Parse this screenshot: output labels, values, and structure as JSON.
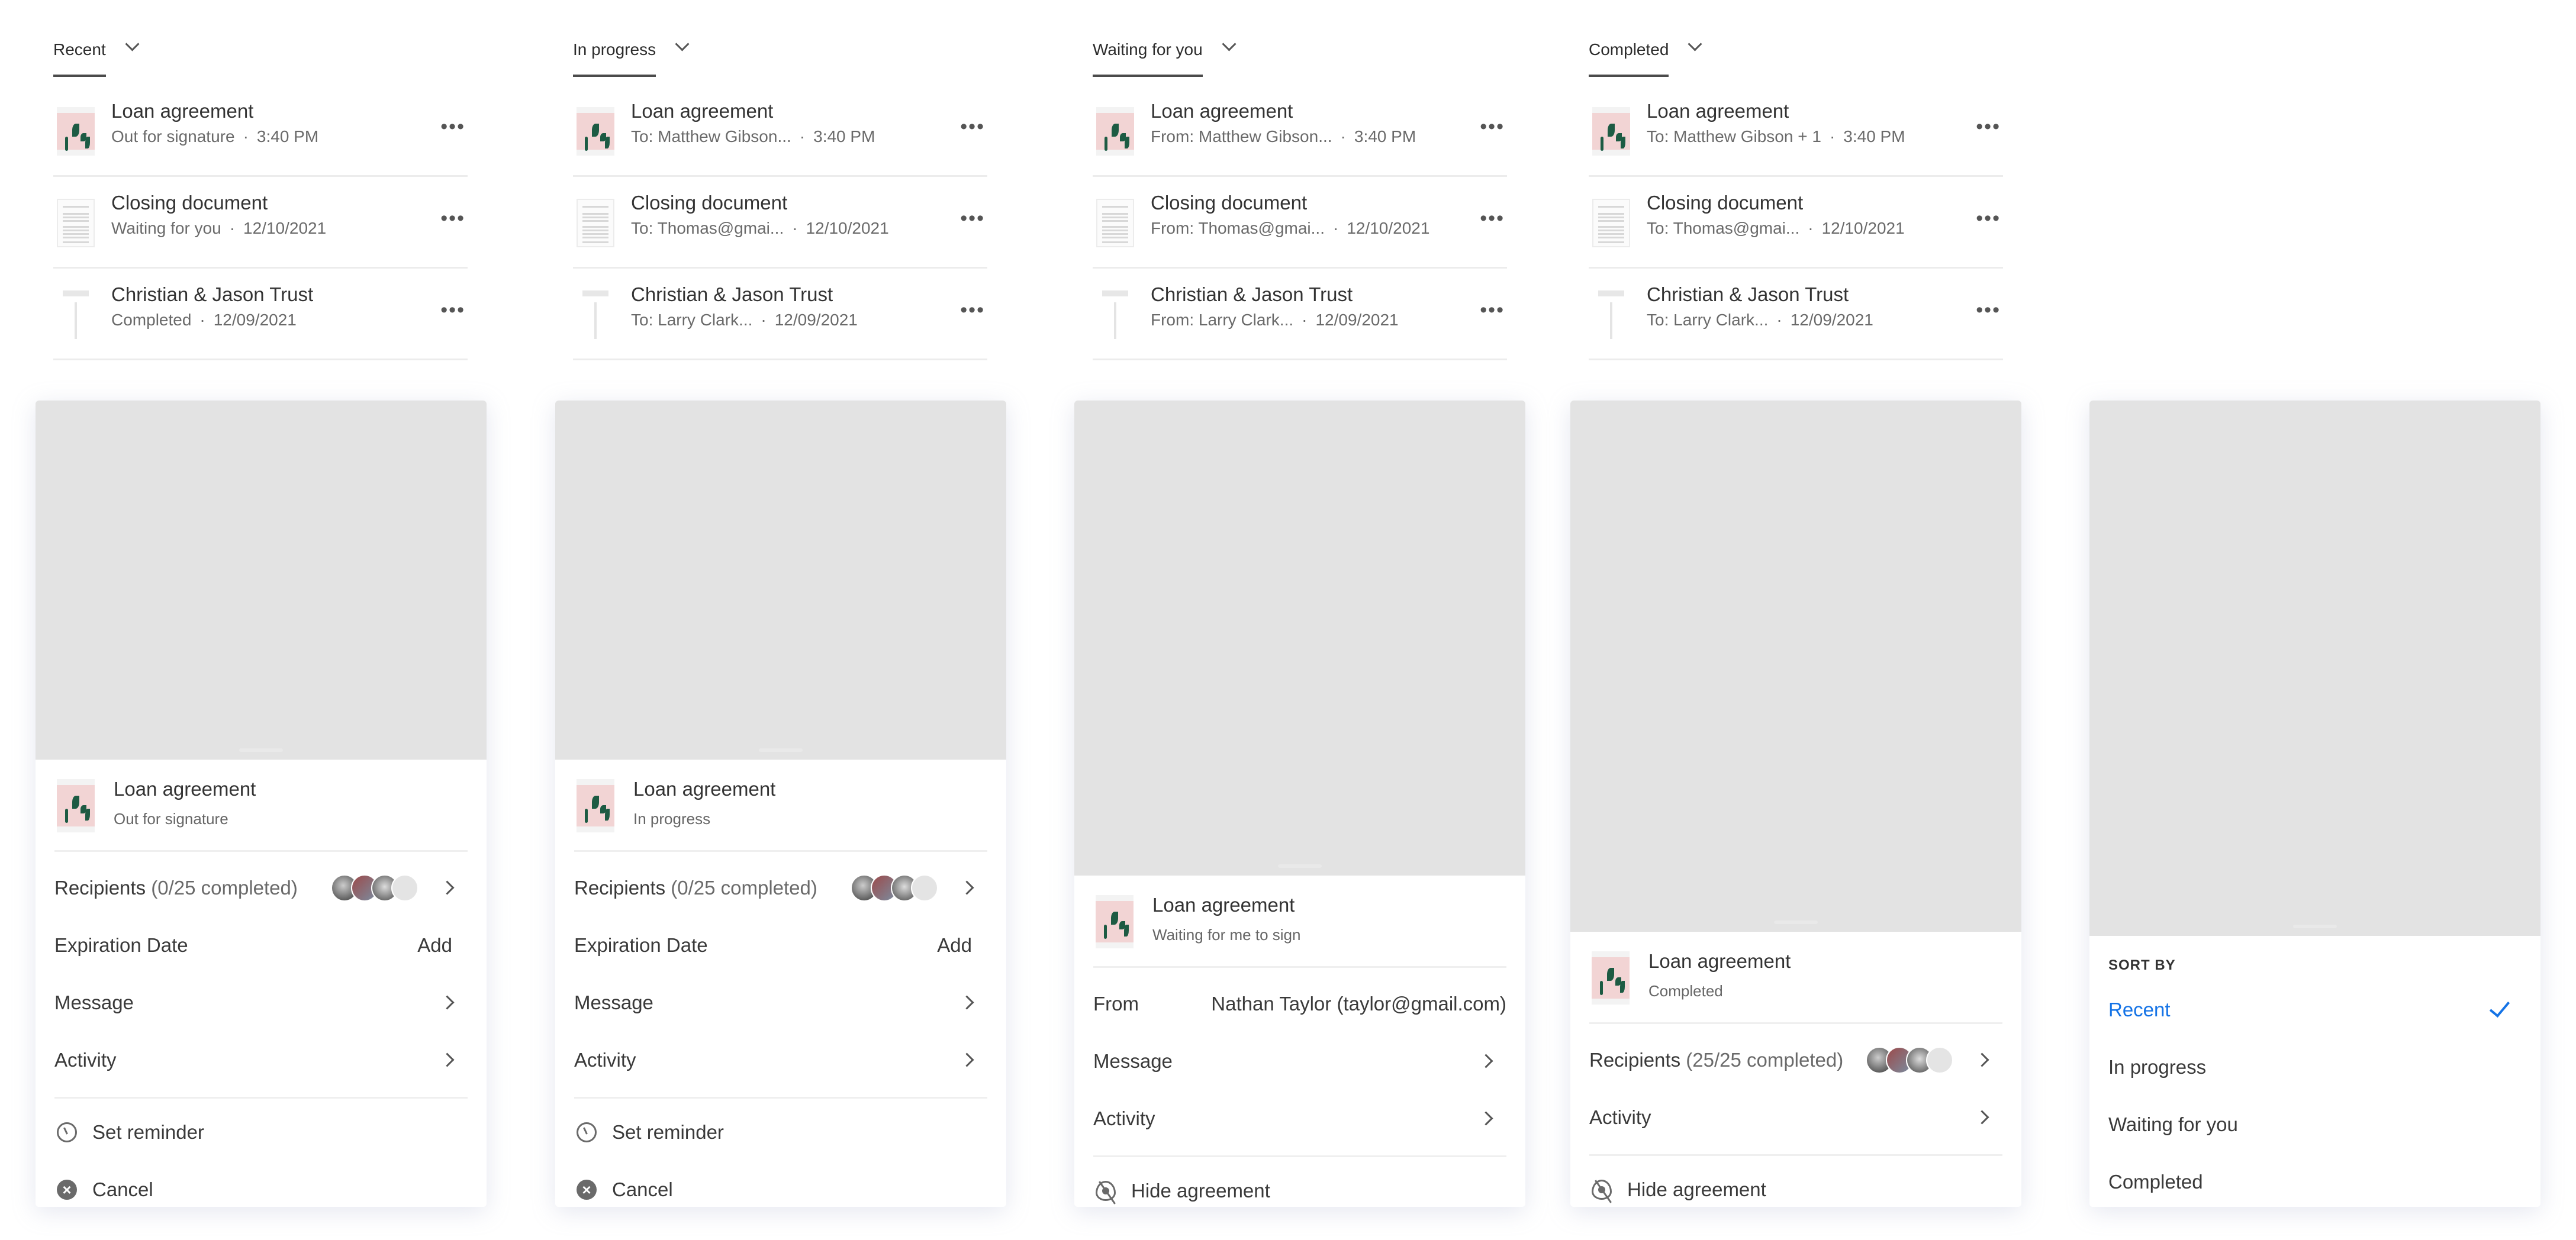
{
  "colors": {
    "accent": "#1473e6",
    "text": "#333333",
    "muted": "#6a6a6a",
    "backdrop": "#e3e3e3",
    "thumb_pink": "#f2d4d4",
    "thumb_green": "#1d5b43"
  },
  "lists": [
    {
      "tab": "Recent",
      "rows": [
        {
          "thumb": "loan",
          "title": "Loan agreement",
          "sub": "Out for signature",
          "time": "3:40 PM"
        },
        {
          "thumb": "doc",
          "title": "Closing document",
          "sub": "Waiting for you",
          "time": "12/10/2021"
        },
        {
          "thumb": "trust",
          "title": "Christian & Jason Trust",
          "sub": "Completed",
          "time": "12/09/2021"
        }
      ]
    },
    {
      "tab": "In progress",
      "rows": [
        {
          "thumb": "loan",
          "title": "Loan agreement",
          "sub": "To: Matthew Gibson...",
          "time": "3:40 PM"
        },
        {
          "thumb": "doc",
          "title": "Closing document",
          "sub": "To: Thomas@gmai...",
          "time": "12/10/2021"
        },
        {
          "thumb": "trust",
          "title": "Christian & Jason Trust",
          "sub": "To: Larry Clark...",
          "time": "12/09/2021"
        }
      ]
    },
    {
      "tab": "Waiting for you",
      "rows": [
        {
          "thumb": "loan",
          "title": "Loan agreement",
          "sub": "From: Matthew Gibson...",
          "time": "3:40 PM"
        },
        {
          "thumb": "doc",
          "title": "Closing document",
          "sub": "From: Thomas@gmai...",
          "time": "12/10/2021"
        },
        {
          "thumb": "trust",
          "title": "Christian & Jason Trust",
          "sub": "From: Larry Clark...",
          "time": "12/09/2021"
        }
      ]
    },
    {
      "tab": "Completed",
      "rows": [
        {
          "thumb": "loan",
          "title": "Loan agreement",
          "sub": "To: Matthew Gibson + 1",
          "time": "3:40 PM"
        },
        {
          "thumb": "doc",
          "title": "Closing document",
          "sub": "To: Thomas@gmai...",
          "time": "12/10/2021"
        },
        {
          "thumb": "trust",
          "title": "Christian & Jason Trust",
          "sub": "To: Larry Clark...",
          "time": "12/09/2021"
        }
      ]
    }
  ],
  "more_icon": "•••",
  "panels": {
    "out_for_signature": {
      "title": "Loan agreement",
      "status": "Out for signature",
      "recipients_label": "Recipients",
      "recipients_count": "(0/25 completed)",
      "expiration_label": "Expiration Date",
      "expiration_action": "Add",
      "message_label": "Message",
      "activity_label": "Activity",
      "reminder_label": "Set reminder",
      "cancel_label": "Cancel"
    },
    "in_progress": {
      "title": "Loan agreement",
      "status": "In progress",
      "recipients_label": "Recipients",
      "recipients_count": "(0/25 completed)",
      "expiration_label": "Expiration Date",
      "expiration_action": "Add",
      "message_label": "Message",
      "activity_label": "Activity",
      "reminder_label": "Set reminder",
      "cancel_label": "Cancel"
    },
    "waiting": {
      "title": "Loan agreement",
      "status": "Waiting for me to sign",
      "from_label": "From",
      "from_value": "Nathan Taylor (taylor@gmail.com)",
      "message_label": "Message",
      "activity_label": "Activity",
      "hide_label": "Hide agreement"
    },
    "completed": {
      "title": "Loan agreement",
      "status": "Completed",
      "recipients_label": "Recipients",
      "recipients_count": "(25/25 completed)",
      "activity_label": "Activity",
      "hide_label": "Hide agreement"
    },
    "sort": {
      "heading": "SORT BY",
      "options": [
        {
          "label": "Recent",
          "selected": true
        },
        {
          "label": "In progress",
          "selected": false
        },
        {
          "label": "Waiting for you",
          "selected": false
        },
        {
          "label": "Completed",
          "selected": false
        }
      ]
    }
  }
}
